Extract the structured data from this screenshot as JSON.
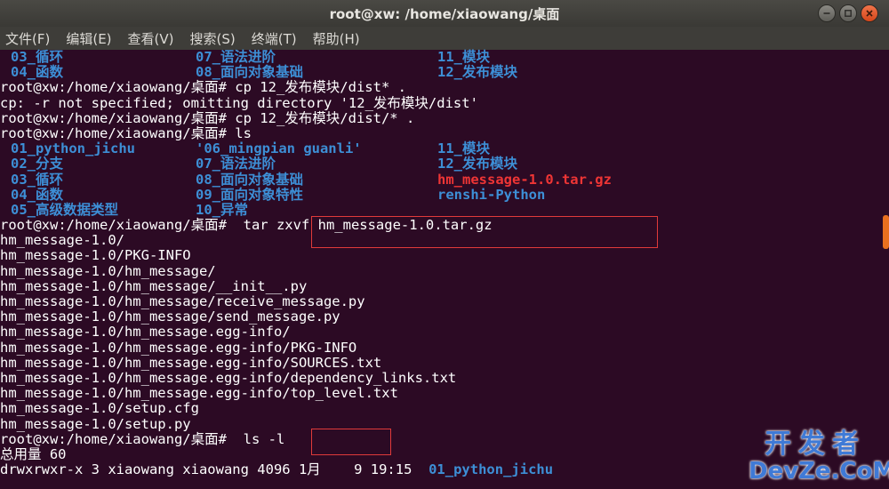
{
  "window": {
    "title": "root@xw: /home/xiaowang/桌面",
    "buttons": {
      "minimize_icon": "minimize-icon",
      "maximize_icon": "maximize-icon",
      "close_icon": "close-icon"
    }
  },
  "menu": [
    "文件(F)",
    "编辑(E)",
    "查看(V)",
    "搜索(S)",
    "终端(T)",
    "帮助(H)"
  ],
  "terminal": {
    "lines": [
      {
        "type": "cols",
        "cols": [
          {
            "t": "03_循环",
            "c": "blue"
          },
          {
            "t": "07_语法进阶",
            "c": "blue"
          },
          {
            "t": "11_模块",
            "c": "blue"
          }
        ]
      },
      {
        "type": "cols",
        "cols": [
          {
            "t": "04_函数",
            "c": "blue"
          },
          {
            "t": "08_面向对象基础",
            "c": "blue"
          },
          {
            "t": "12_发布模块",
            "c": "blue"
          }
        ]
      },
      {
        "type": "text",
        "text": "root@xw:/home/xiaowang/桌面# cp 12_发布模块/dist* ."
      },
      {
        "type": "text",
        "text": "cp: -r not specified; omitting directory '12_发布模块/dist'"
      },
      {
        "type": "text",
        "text": "root@xw:/home/xiaowang/桌面# cp 12_发布模块/dist/* ."
      },
      {
        "type": "text",
        "text": "root@xw:/home/xiaowang/桌面# ls"
      },
      {
        "type": "cols",
        "cols": [
          {
            "t": "01_python_jichu",
            "c": "blue"
          },
          {
            "t": "'06_mingpian guanli'",
            "c": "blue"
          },
          {
            "t": "11_模块",
            "c": "blue"
          }
        ]
      },
      {
        "type": "cols",
        "cols": [
          {
            "t": "02_分支",
            "c": "blue"
          },
          {
            "t": "07_语法进阶",
            "c": "blue"
          },
          {
            "t": "12_发布模块",
            "c": "blue"
          }
        ]
      },
      {
        "type": "cols",
        "cols": [
          {
            "t": "03_循环",
            "c": "blue"
          },
          {
            "t": "08_面向对象基础",
            "c": "blue"
          },
          {
            "t": "hm_message-1.0.tar.gz",
            "c": "red"
          }
        ]
      },
      {
        "type": "cols",
        "cols": [
          {
            "t": "04_函数",
            "c": "blue"
          },
          {
            "t": "09_面向对象特性",
            "c": "blue"
          },
          {
            "t": "renshi-Python",
            "c": "blue"
          }
        ]
      },
      {
        "type": "cols",
        "cols": [
          {
            "t": "05_高级数据类型",
            "c": "blue"
          },
          {
            "t": "10_异常",
            "c": "blue"
          },
          {
            "t": "",
            "c": "blue"
          }
        ]
      },
      {
        "type": "text",
        "text": "root@xw:/home/xiaowang/桌面#  tar zxvf hm_message-1.0.tar.gz"
      },
      {
        "type": "text",
        "text": "hm_message-1.0/"
      },
      {
        "type": "text",
        "text": "hm_message-1.0/PKG-INFO"
      },
      {
        "type": "text",
        "text": "hm_message-1.0/hm_message/"
      },
      {
        "type": "text",
        "text": "hm_message-1.0/hm_message/__init__.py"
      },
      {
        "type": "text",
        "text": "hm_message-1.0/hm_message/receive_message.py"
      },
      {
        "type": "text",
        "text": "hm_message-1.0/hm_message/send_message.py"
      },
      {
        "type": "text",
        "text": "hm_message-1.0/hm_message.egg-info/"
      },
      {
        "type": "text",
        "text": "hm_message-1.0/hm_message.egg-info/PKG-INFO"
      },
      {
        "type": "text",
        "text": "hm_message-1.0/hm_message.egg-info/SOURCES.txt"
      },
      {
        "type": "text",
        "text": "hm_message-1.0/hm_message.egg-info/dependency_links.txt"
      },
      {
        "type": "text",
        "text": "hm_message-1.0/hm_message.egg-info/top_level.txt"
      },
      {
        "type": "text",
        "text": "hm_message-1.0/setup.cfg"
      },
      {
        "type": "text",
        "text": "hm_message-1.0/setup.py"
      },
      {
        "type": "text",
        "text": "root@xw:/home/xiaowang/桌面#  ls -l"
      },
      {
        "type": "text",
        "text": "总用量 60"
      },
      {
        "type": "mixed",
        "parts": [
          {
            "t": "drwxrwxr-x 3 xiaowang xiaowang 4096 1月    9 19:15  ",
            "c": ""
          },
          {
            "t": "01_python_jichu",
            "c": "blue"
          }
        ]
      }
    ]
  },
  "highlight_color": "#e03a3a",
  "watermark": {
    "cn": "开发者",
    "en": "DevZe.CoM"
  }
}
